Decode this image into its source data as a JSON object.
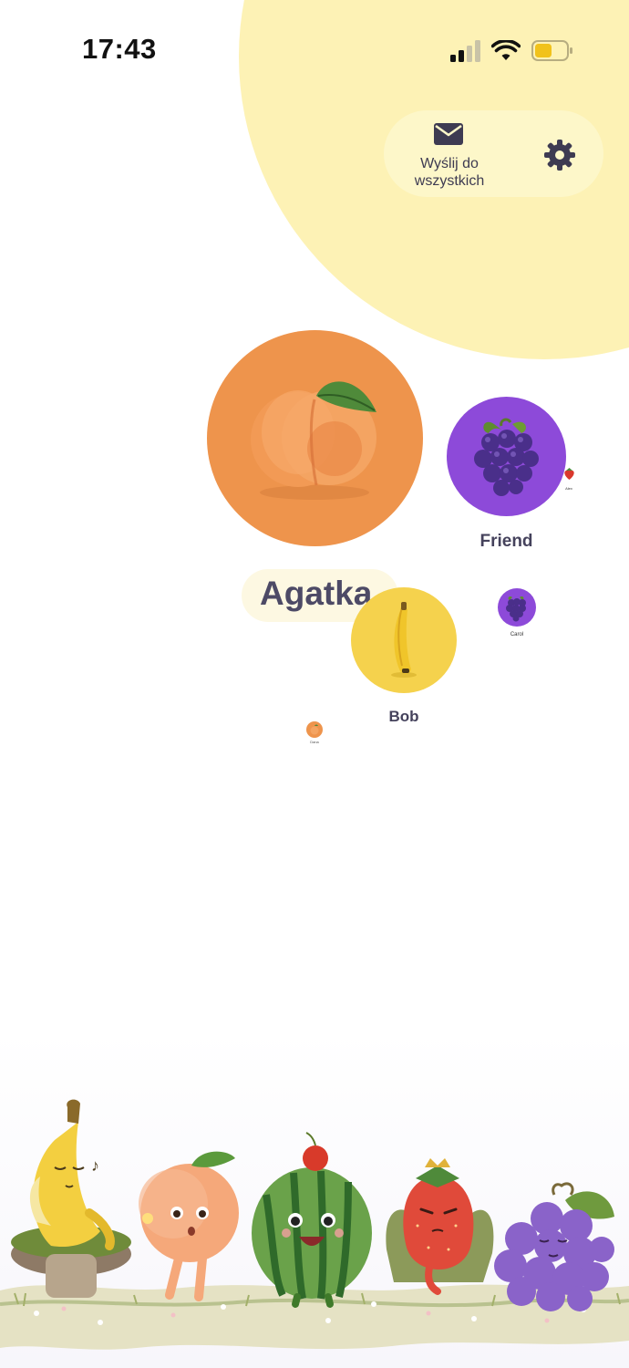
{
  "status_bar": {
    "time": "17:43",
    "icons": [
      "cellular-signal-icon",
      "wifi-icon",
      "battery-icon"
    ]
  },
  "header": {
    "send_all_label": "Wyślij do wszystkich",
    "send_all_icon": "envelope-icon",
    "settings_icon": "gear-icon"
  },
  "contacts": [
    {
      "name": "Agatka",
      "fruit": "peach",
      "color": "#ee944c"
    },
    {
      "name": "Friend",
      "fruit": "grapes",
      "color": "#8d4ad9"
    },
    {
      "name": "Bob",
      "fruit": "banana",
      "color": "#f5d24d"
    },
    {
      "name": "Carol",
      "fruit": "grapes",
      "color": "#8d4ad9"
    },
    {
      "name": "Dana",
      "fruit": "peach",
      "color": "#ee944c"
    },
    {
      "name": "Alex",
      "fruit": "strawberry",
      "color": "#d9382c"
    }
  ],
  "colors": {
    "sun": "#fdf2b5",
    "pill": "#fdf7c9",
    "text": "#45425c"
  }
}
